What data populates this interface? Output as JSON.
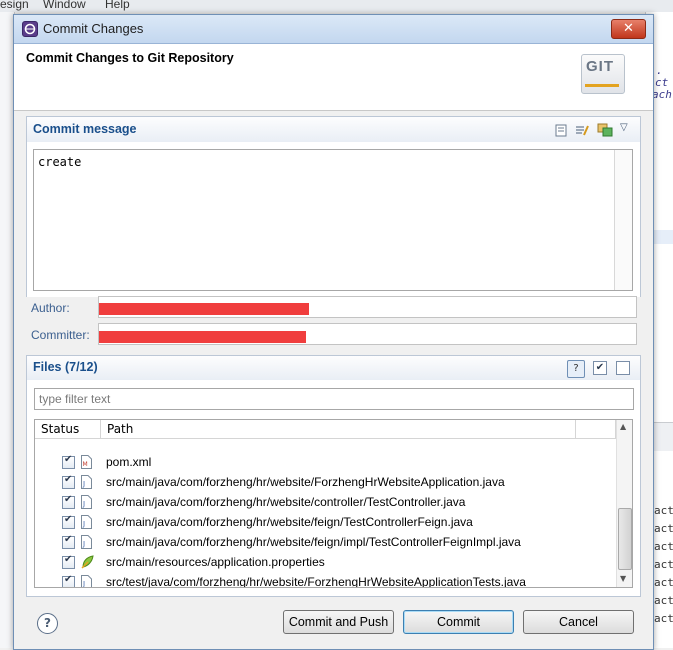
{
  "background": {
    "menu": [
      "esign",
      "Window",
      "Help"
    ],
    "right_code": [
      ".",
      "ct",
      "ach",
      "act",
      "act",
      "act",
      "act",
      "act",
      "act",
      "act"
    ]
  },
  "dialog": {
    "title": "Commit Changes",
    "close_label": "✕",
    "header_title": "Commit Changes to Git Repository",
    "git_logo_text": "GIT"
  },
  "commit_message": {
    "title": "Commit message",
    "text": "create"
  },
  "author": {
    "label": "Author:",
    "value_redacted": true
  },
  "committer": {
    "label": "Committer:",
    "value_redacted": true
  },
  "files": {
    "title": "Files (7/12)",
    "filter_placeholder": "type filter text",
    "columns": [
      "Status",
      "Path"
    ],
    "rows": [
      {
        "path": "pom.xml",
        "checked": true,
        "icon": "xml-file-icon"
      },
      {
        "path": "src/main/java/com/forzheng/hr/website/ForzhengHrWebsiteApplication.java",
        "checked": true,
        "icon": "java-file-icon"
      },
      {
        "path": "src/main/java/com/forzheng/hr/website/controller/TestController.java",
        "checked": true,
        "icon": "java-file-icon"
      },
      {
        "path": "src/main/java/com/forzheng/hr/website/feign/TestControllerFeign.java",
        "checked": true,
        "icon": "java-file-icon"
      },
      {
        "path": "src/main/java/com/forzheng/hr/website/feign/impl/TestControllerFeignImpl.java",
        "checked": true,
        "icon": "java-file-icon"
      },
      {
        "path": "src/main/resources/application.properties",
        "checked": true,
        "icon": "properties-file-icon"
      },
      {
        "path": "src/test/java/com/forzheng/hr/website/ForzhengHrWebsiteApplicationTests.java",
        "checked": true,
        "icon": "java-file-icon"
      }
    ]
  },
  "buttons": {
    "commit_and_push": "Commit and Push",
    "commit": "Commit",
    "cancel": "Cancel",
    "help": "?"
  },
  "colors": {
    "section_title": "#1a4f8b",
    "close_button": "#c0361b",
    "redaction": "#f03e3e"
  }
}
